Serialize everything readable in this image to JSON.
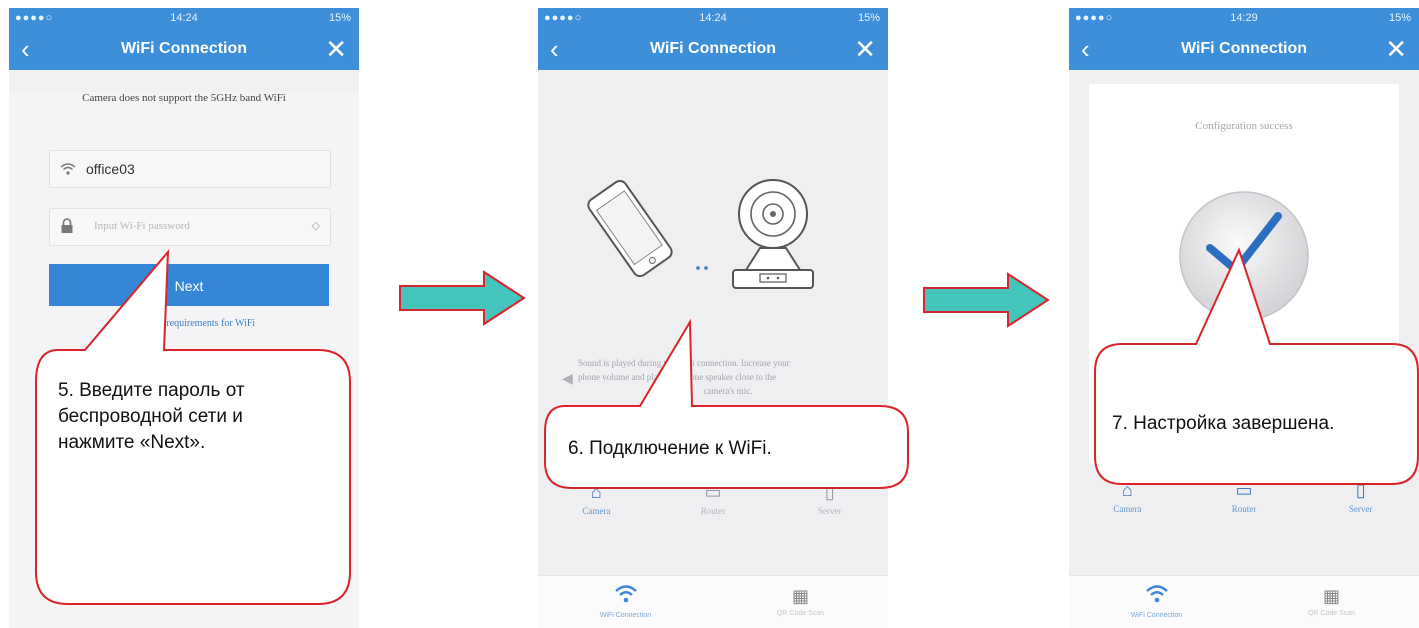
{
  "screens": [
    {
      "status": {
        "signal": "●●●●○",
        "time": "14:24",
        "battery": "15%"
      },
      "nav": {
        "back": "‹",
        "title": "WiFi Connection",
        "close": "✕"
      },
      "note": "Camera does not support the 5GHz band WiFi",
      "ssid_field": {
        "icon": "wifi-icon",
        "value": "office03"
      },
      "password_field": {
        "icon": "lock-icon",
        "placeholder": "Input Wi-Fi password",
        "eye": "◇"
      },
      "next_label": "Next",
      "requirements_link": "What are the requirements for WiFi",
      "callout": {
        "line1": "5. Введите пароль от",
        "line2": "беспроводной сети и",
        "line3": "нажмите «Next»."
      }
    },
    {
      "status": {
        "signal": "●●●●○",
        "time": "14:24",
        "battery": "15%"
      },
      "nav": {
        "back": "‹",
        "title": "WiFi Connection",
        "close": "✕"
      },
      "hint": {
        "line1": "Sound is played during the WiFi connection. Increase your",
        "line2": "phone volume and place the phone speaker close to the",
        "line3": "camera's mic."
      },
      "steps": [
        "Camera",
        "Router",
        "Server"
      ],
      "tabs": [
        "WiFi Connection",
        "QR Code Scan"
      ],
      "callout": "6. Подключение к WiFi."
    },
    {
      "status": {
        "signal": "●●●●○",
        "time": "14:29",
        "battery": "15%"
      },
      "nav": {
        "back": "‹",
        "title": "WiFi Connection",
        "close": "✕"
      },
      "success": "Configuration success",
      "steps": [
        "Camera",
        "Router",
        "Server"
      ],
      "tabs": [
        "WiFi Connection",
        "QR Code Scan"
      ],
      "callout": "7. Настройка завершена."
    }
  ],
  "colors": {
    "header": "#3d8fd9",
    "button": "#3586d6",
    "arrow": "#45c4bd",
    "callout_border": "#d9242b"
  }
}
